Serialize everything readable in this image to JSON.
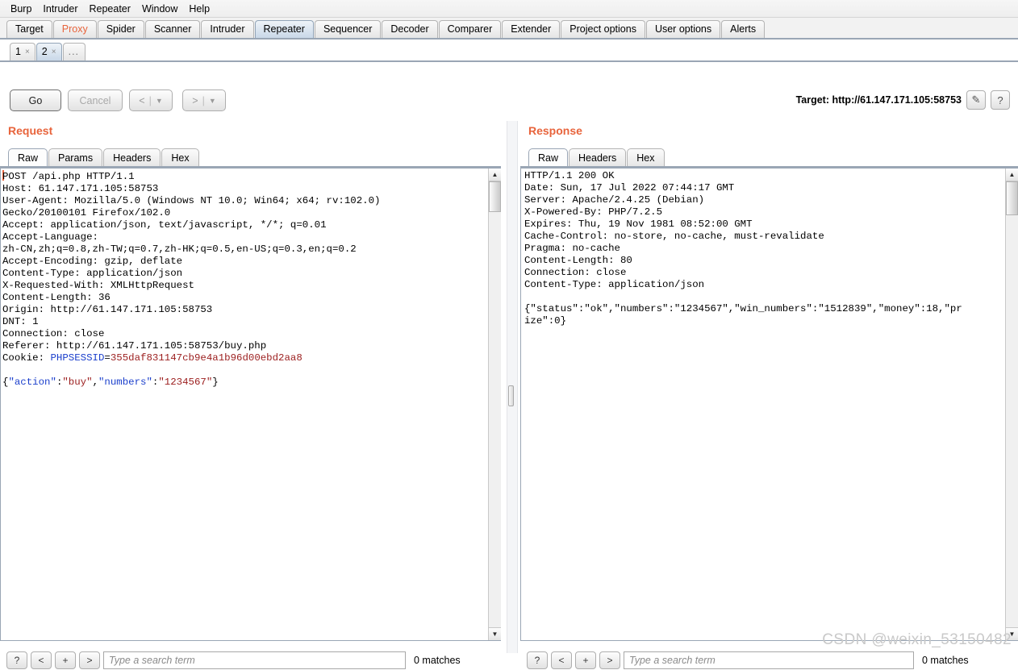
{
  "menu": {
    "items": [
      "Burp",
      "Intruder",
      "Repeater",
      "Window",
      "Help"
    ]
  },
  "main_tabs": {
    "items": [
      {
        "label": "Target",
        "state": "normal"
      },
      {
        "label": "Proxy",
        "state": "alert"
      },
      {
        "label": "Spider",
        "state": "normal"
      },
      {
        "label": "Scanner",
        "state": "normal"
      },
      {
        "label": "Intruder",
        "state": "normal"
      },
      {
        "label": "Repeater",
        "state": "active"
      },
      {
        "label": "Sequencer",
        "state": "normal"
      },
      {
        "label": "Decoder",
        "state": "normal"
      },
      {
        "label": "Comparer",
        "state": "normal"
      },
      {
        "label": "Extender",
        "state": "normal"
      },
      {
        "label": "Project options",
        "state": "normal"
      },
      {
        "label": "User options",
        "state": "normal"
      },
      {
        "label": "Alerts",
        "state": "normal"
      }
    ]
  },
  "repeater_tabs": {
    "items": [
      {
        "label": "1",
        "close": "×",
        "state": "normal"
      },
      {
        "label": "2",
        "close": "×",
        "state": "active"
      }
    ],
    "more_label": "..."
  },
  "toolbar": {
    "go_label": "Go",
    "cancel_label": "Cancel",
    "back_label": "<",
    "back_arrow": "▼",
    "forward_label": ">",
    "forward_arrow": "▼",
    "separator": "|"
  },
  "target": {
    "label": "Target: http://61.147.171.105:58753",
    "edit_icon": "✎",
    "help_icon": "?"
  },
  "request": {
    "title": "Request",
    "tabs": [
      {
        "label": "Raw",
        "state": "active"
      },
      {
        "label": "Params",
        "state": "normal"
      },
      {
        "label": "Headers",
        "state": "normal"
      },
      {
        "label": "Hex",
        "state": "normal"
      }
    ],
    "lines": [
      "POST /api.php HTTP/1.1",
      "Host: 61.147.171.105:58753",
      "User-Agent: Mozilla/5.0 (Windows NT 10.0; Win64; x64; rv:102.0)",
      "Gecko/20100101 Firefox/102.0",
      "Accept: application/json, text/javascript, */*; q=0.01",
      "Accept-Language:",
      "zh-CN,zh;q=0.8,zh-TW;q=0.7,zh-HK;q=0.5,en-US;q=0.3,en;q=0.2",
      "Accept-Encoding: gzip, deflate",
      "Content-Type: application/json",
      "X-Requested-With: XMLHttpRequest",
      "Content-Length: 36",
      "Origin: http://61.147.171.105:58753",
      "DNT: 1",
      "Connection: close",
      "Referer: http://61.147.171.105:58753/buy.php"
    ],
    "cookie_label": "Cookie: ",
    "cookie_name": "PHPSESSID",
    "cookie_eq": "=",
    "cookie_value": "355daf831147cb9e4a1b96d00ebd2aa8",
    "body": {
      "open": "{",
      "key1": "\"action\"",
      "colon1": ":",
      "val1": "\"buy\"",
      "comma": ",",
      "key2": "\"numbers\"",
      "colon2": ":",
      "val2": "\"1234567\"",
      "close": "}"
    },
    "search": {
      "help_label": "?",
      "prev_label": "<",
      "add_label": "+",
      "next_label": ">",
      "placeholder": "Type a search term",
      "matches": "0 matches"
    }
  },
  "response": {
    "title": "Response",
    "tabs": [
      {
        "label": "Raw",
        "state": "active"
      },
      {
        "label": "Headers",
        "state": "normal"
      },
      {
        "label": "Hex",
        "state": "normal"
      }
    ],
    "lines": [
      "HTTP/1.1 200 OK",
      "Date: Sun, 17 Jul 2022 07:44:17 GMT",
      "Server: Apache/2.4.25 (Debian)",
      "X-Powered-By: PHP/7.2.5",
      "Expires: Thu, 19 Nov 1981 08:52:00 GMT",
      "Cache-Control: no-store, no-cache, must-revalidate",
      "Pragma: no-cache",
      "Content-Length: 80",
      "Connection: close",
      "Content-Type: application/json",
      "",
      "{\"status\":\"ok\",\"numbers\":\"1234567\",\"win_numbers\":\"1512839\",\"money\":18,\"pr",
      "ize\":0}"
    ],
    "search": {
      "help_label": "?",
      "prev_label": "<",
      "add_label": "+",
      "next_label": ">",
      "placeholder": "Type a search term",
      "matches": "0 matches"
    }
  },
  "scroll": {
    "up_arrow": "▲",
    "down_arrow": "▼"
  },
  "watermark": "CSDN @weixin_53150482"
}
